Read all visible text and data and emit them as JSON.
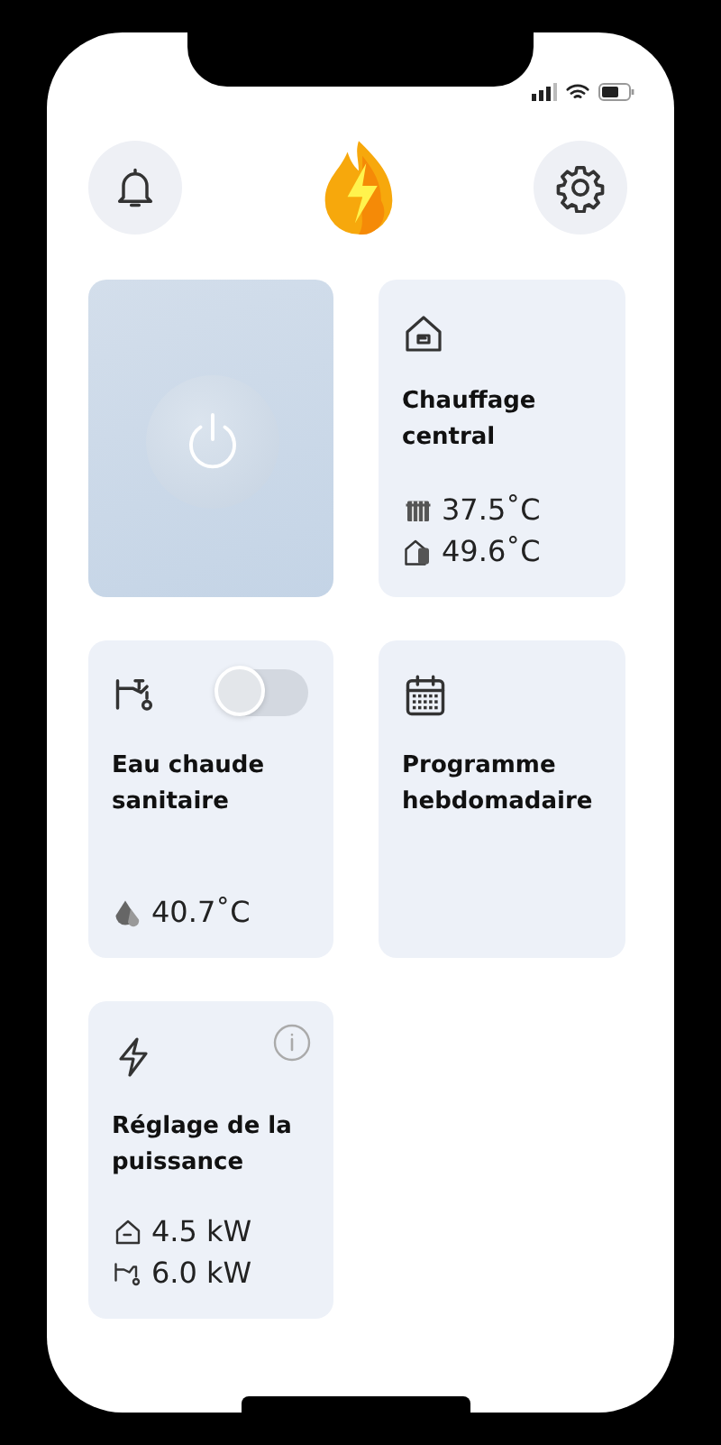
{
  "cards": [
    {
      "kind": "power",
      "on": false
    },
    {
      "kind": "readings",
      "title": "Chauffage central",
      "readings": [
        {
          "kind": "radiator",
          "value": "37.5˚C"
        },
        {
          "kind": "house-tank",
          "value": "49.6˚C"
        }
      ]
    },
    {
      "kind": "readings",
      "title": "Eau chaude sanitaire",
      "toggle": {
        "on": false
      },
      "readings": [
        {
          "kind": "drop",
          "value": "40.7˚C"
        }
      ]
    },
    {
      "kind": "schedule",
      "title": "Programme hebdomadaire"
    },
    {
      "kind": "readings",
      "title": "Réglage de la puissance",
      "info": true,
      "readings": [
        {
          "kind": "house",
          "value": "4.5 kW"
        },
        {
          "kind": "tap",
          "value": "6.0 kW"
        }
      ]
    }
  ]
}
